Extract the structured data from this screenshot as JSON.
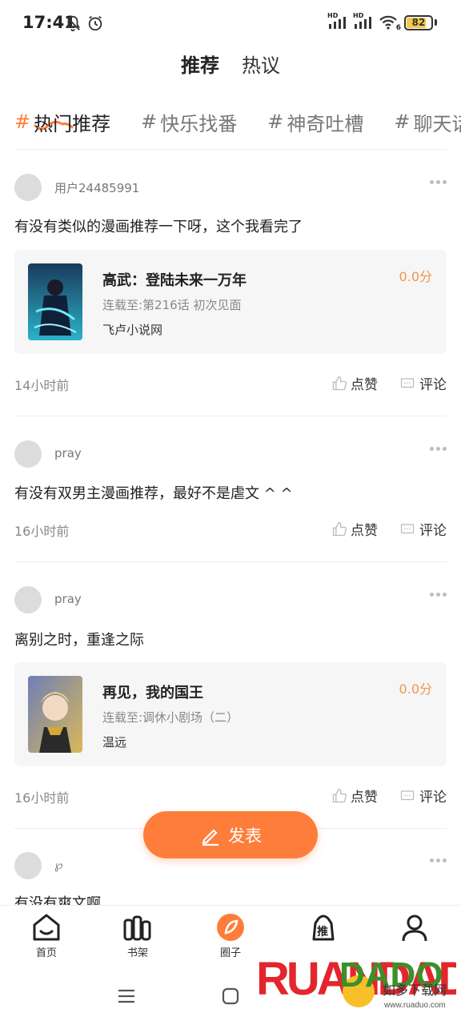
{
  "status": {
    "time": "17:41",
    "battery": "82",
    "battery_pct": 82,
    "signal1_label": "HD",
    "signal2_label": "HD",
    "wifi_sub": "6"
  },
  "main_tabs": [
    {
      "label": "推荐",
      "active": true
    },
    {
      "label": "热议",
      "active": false
    }
  ],
  "topic_tabs": [
    {
      "hash": "#",
      "label": "热门推荐",
      "active": true
    },
    {
      "hash": "#",
      "label": "快乐找番",
      "active": false
    },
    {
      "hash": "#",
      "label": "神奇吐槽",
      "active": false
    },
    {
      "hash": "#",
      "label": "聊天话题",
      "active": false
    }
  ],
  "posts": [
    {
      "username": "用户24485991",
      "text": "有没有类似的漫画推荐一下呀，这个我看完了",
      "book": {
        "title": "高武：登陆未来一万年",
        "progress": "连载至:第216话 初次见面",
        "source": "飞卢小说网",
        "score": "0.0分"
      },
      "time": "14小时前",
      "like_label": "点赞",
      "comment_label": "评论"
    },
    {
      "username": "pray",
      "text": "有没有双男主漫画推荐，最好不是虐文 ^ ^",
      "time": "16小时前",
      "like_label": "点赞",
      "comment_label": "评论"
    },
    {
      "username": "pray",
      "text": "离别之时，重逢之际",
      "book": {
        "title": "再见，我的国王",
        "progress": "连载至:调休小剧场（二）",
        "source": "温远",
        "score": "0.0分"
      },
      "time": "16小时前",
      "like_label": "点赞",
      "comment_label": "评论"
    },
    {
      "username": "℘",
      "text": "有没有爽文啊"
    }
  ],
  "publish_label": "发表",
  "bottom_nav": [
    {
      "label": "首页",
      "icon": "home-icon"
    },
    {
      "label": "书架",
      "icon": "bookshelf-icon"
    },
    {
      "label": "圈子",
      "icon": "circle-icon",
      "active": true
    },
    {
      "label": "推",
      "icon": "recommend-bag-icon"
    },
    {
      "label": "",
      "icon": "profile-icon"
    }
  ],
  "watermark": {
    "brand": "RUANDADO",
    "cn": "如多下载网",
    "url": "www.ruaduo.com"
  },
  "colors": {
    "accent": "#ff7d3a",
    "score": "#f0964a",
    "card_bg": "#f6f6f6"
  }
}
